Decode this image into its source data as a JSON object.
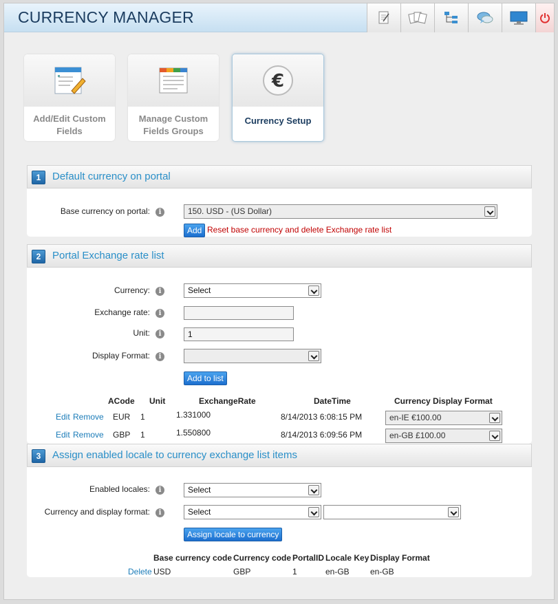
{
  "app": {
    "title": "CURRENCY MANAGER"
  },
  "toolbar": {
    "icons": [
      "notepad-icon",
      "cards-icon",
      "tree-icon",
      "chat-icon",
      "monitor-icon",
      "power-icon"
    ]
  },
  "tiles": [
    {
      "label": "Add/Edit Custom Fields"
    },
    {
      "label": "Manage Custom Fields Groups"
    },
    {
      "label": "Currency Setup",
      "active": true
    }
  ],
  "section1": {
    "number": "1",
    "title": "Default currency on portal",
    "base_label": "Base currency on portal:",
    "base_value": "150. USD - (US Dollar)",
    "add_label": "Add",
    "reset_text": "Reset base currency and delete Exchange rate list"
  },
  "section2": {
    "number": "2",
    "title": "Portal Exchange rate list",
    "currency_label": "Currency:",
    "currency_value": "Select",
    "rate_label": "Exchange rate:",
    "rate_value": "",
    "unit_label": "Unit:",
    "unit_value": "1",
    "format_label": "Display Format:",
    "format_value": "",
    "add_to_list_label": "Add to list",
    "columns": [
      "ACode",
      "Unit",
      "ExchangeRate",
      "DateTime",
      "Currency Display Format"
    ],
    "rows": [
      {
        "edit": "Edit",
        "remove": "Remove",
        "acode": "EUR",
        "unit": "1",
        "rate": "1.331000",
        "datetime": "8/14/2013 6:08:15 PM",
        "format": "en-IE €100.00"
      },
      {
        "edit": "Edit",
        "remove": "Remove",
        "acode": "GBP",
        "unit": "1",
        "rate": "1.550800",
        "datetime": "8/14/2013 6:09:56 PM",
        "format": "en-GB £100.00"
      }
    ]
  },
  "section3": {
    "number": "3",
    "title": "Assign enabled locale to currency exchange list items",
    "locales_label": "Enabled locales:",
    "locales_value": "Select",
    "cdf_label": "Currency and display format:",
    "cdf_value": "Select",
    "cdf_value2": "",
    "assign_label": "Assign locale to currency",
    "columns": [
      "Base currency code",
      "Currency code",
      "PortalID",
      "Locale Key",
      "Display Format"
    ],
    "rows": [
      {
        "delete": "Delete",
        "base": "USD",
        "currency": "GBP",
        "portal": "1",
        "locale": "en-GB",
        "format": "en-GB"
      }
    ]
  }
}
